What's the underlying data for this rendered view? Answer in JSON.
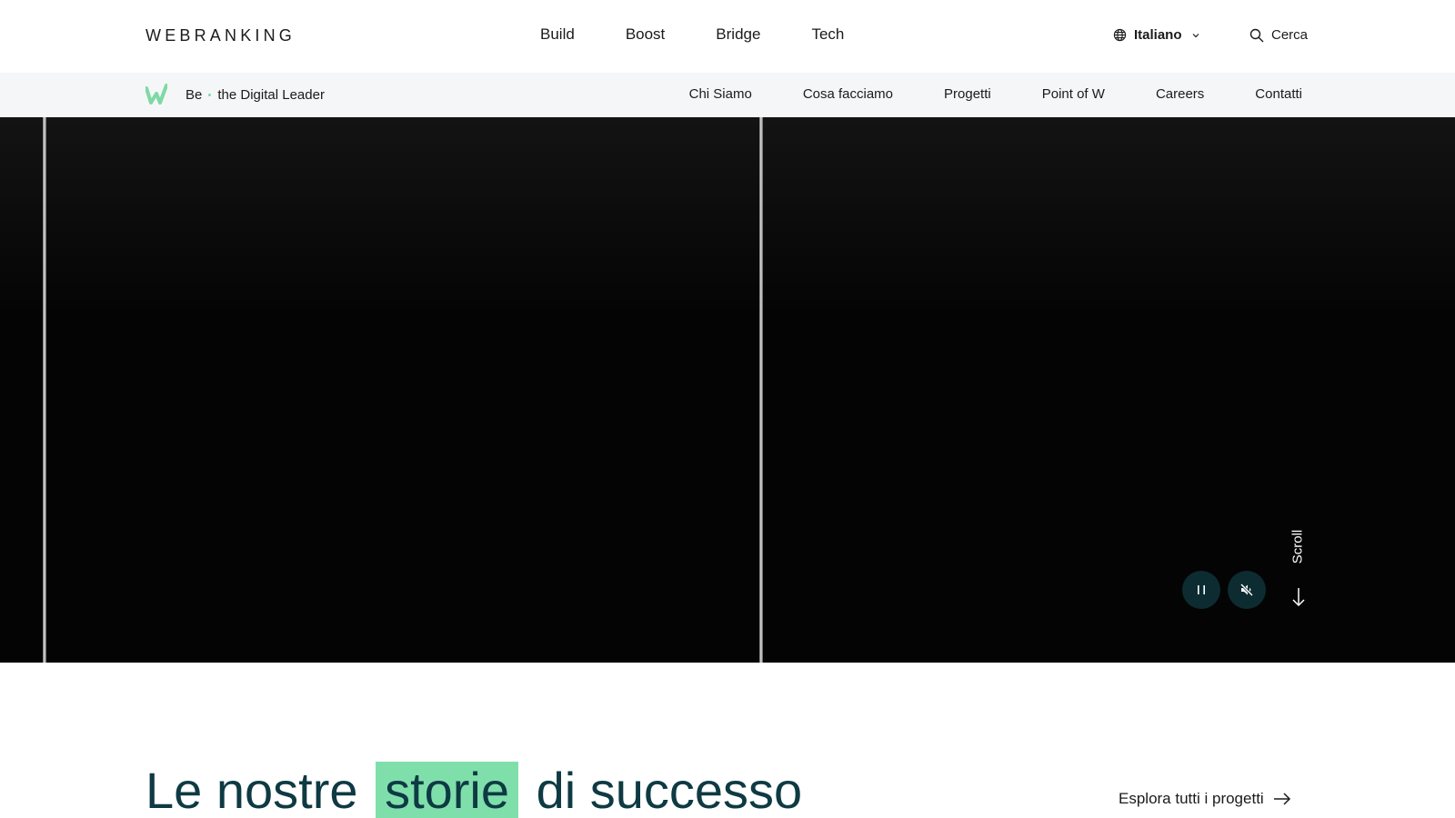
{
  "header": {
    "logo": "WEBRANKING",
    "nav": [
      "Build",
      "Boost",
      "Bridge",
      "Tech"
    ],
    "language": "Italiano",
    "search_label": "Cerca"
  },
  "subheader": {
    "tagline_be": "Be",
    "tagline_rest": "the Digital Leader",
    "nav": [
      "Chi Siamo",
      "Cosa facciamo",
      "Progetti",
      "Point of W",
      "Careers",
      "Contatti"
    ]
  },
  "hero": {
    "scroll_label": "Scroll",
    "icons": {
      "pause": "pause-icon",
      "mute": "mute-icon",
      "scroll": "arrow-down-icon"
    }
  },
  "success": {
    "title_before": "Le nostre",
    "title_highlight": "storie",
    "title_after": "di successo",
    "explore_label": "Esplora tutti i progetti"
  },
  "colors": {
    "accent_green": "#7fdfab",
    "title_teal": "#0e3a43",
    "control_bg": "#0c2c31",
    "subheader_bg": "#f5f6f7"
  }
}
